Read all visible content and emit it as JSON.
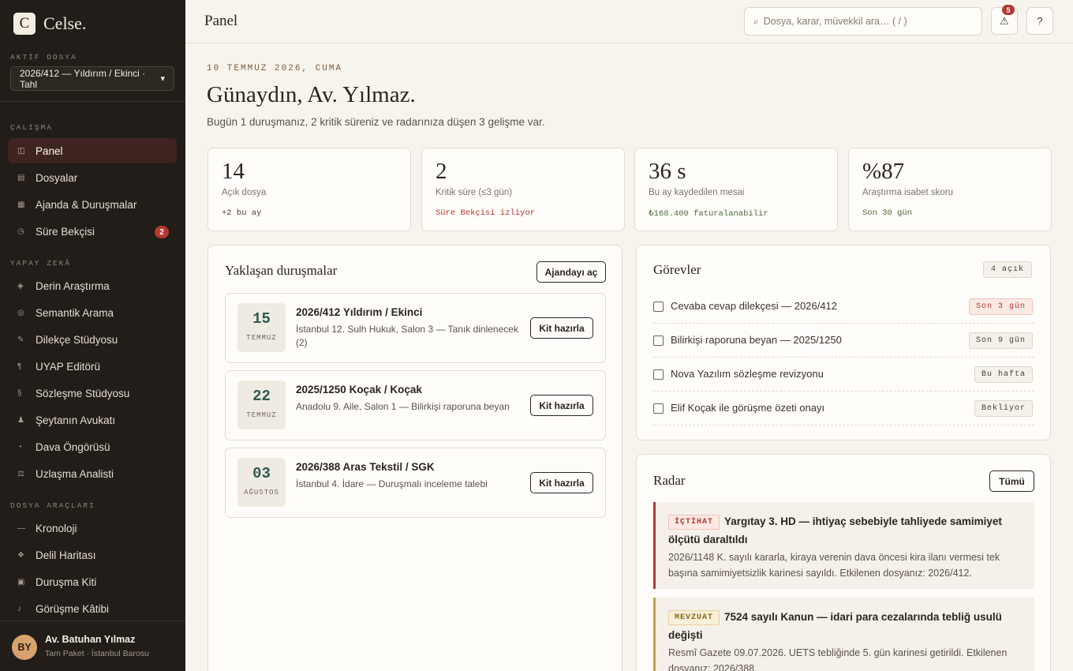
{
  "brand": {
    "mark": "C",
    "name": "Celse."
  },
  "sidebar": {
    "active_case_label": "AKTİF DOSYA",
    "active_case": "2026/412 — Yıldırım / Ekinci · Tahl",
    "sections": {
      "work": "ÇALIŞMA",
      "ai": "YAPAY ZEKÂ",
      "tools": "DOSYA ARAÇLARI"
    },
    "work_items": [
      {
        "label": "Panel",
        "icon": "panel-icon",
        "active": true
      },
      {
        "label": "Dosyalar",
        "icon": "folder-icon"
      },
      {
        "label": "Ajanda & Duruşmalar",
        "icon": "calendar-icon"
      },
      {
        "label": "Süre Bekçisi",
        "icon": "clock-icon",
        "badge": "2"
      }
    ],
    "ai_items": [
      {
        "label": "Derin Araştırma",
        "icon": "diamond-icon"
      },
      {
        "label": "Semantik Arama",
        "icon": "target-icon"
      },
      {
        "label": "Dilekçe Stüdyosu",
        "icon": "pen-icon"
      },
      {
        "label": "UYAP Editörü",
        "icon": "paragraph-icon"
      },
      {
        "label": "Sözleşme Stüdyosu",
        "icon": "section-icon"
      },
      {
        "label": "Şeytanın Avukatı",
        "icon": "person-icon"
      },
      {
        "label": "Dava Öngörüsü",
        "icon": "pie-icon"
      },
      {
        "label": "Uzlaşma Analisti",
        "icon": "handshake-icon"
      }
    ],
    "tool_items": [
      {
        "label": "Kronoloji",
        "icon": "line-icon"
      },
      {
        "label": "Delil Haritası",
        "icon": "cluster-icon"
      },
      {
        "label": "Duruşma Kiti",
        "icon": "kit-icon"
      },
      {
        "label": "Görüşme Kâtibi",
        "icon": "note-icon"
      }
    ],
    "user": {
      "initials": "BY",
      "name": "Av. Batuhan Yılmaz",
      "sub": "Tam Paket · İstanbul Barosu"
    }
  },
  "topbar": {
    "title": "Panel",
    "search_placeholder": "Dosya, karar, müvekkil ara…  ( / )",
    "notif_count": "5",
    "help": "?"
  },
  "header": {
    "date": "10 TEMMUZ 2026, CUMA",
    "greeting": "Günaydın, Av. Yılmaz.",
    "intro": "Bugün 1 duruşmanız, 2 kritik süreniz ve radarınıza düşen 3 gelişme var."
  },
  "stats": [
    {
      "value": "14",
      "label": "Açık dosya",
      "note": "+2 bu ay",
      "tone": "dark"
    },
    {
      "value": "2",
      "label": "Kritik süre (≤3 gün)",
      "note": "Süre Bekçisi izliyor",
      "tone": "red"
    },
    {
      "value": "36 s",
      "label": "Bu ay kaydedilen mesai",
      "note": "₺168.400 faturalanabilir",
      "tone": "green"
    },
    {
      "value": "%87",
      "label": "Araştırma isabet skoru",
      "note": "Son 30 gün",
      "tone": "green"
    }
  ],
  "hearings": {
    "title": "Yaklaşan duruşmalar",
    "open_button": "Ajandayı aç",
    "kit_button": "Kit hazırla",
    "items": [
      {
        "day": "15",
        "month": "TEMMUZ",
        "title": "2026/412 Yıldırım / Ekinci",
        "sub": "İstanbul 12. Sulh Hukuk, Salon 3 — Tanık dinlenecek (2)"
      },
      {
        "day": "22",
        "month": "TEMMUZ",
        "title": "2025/1250 Koçak / Koçak",
        "sub": "Anadolu 9. Aile, Salon 1 — Bilirkişi raporuna beyan"
      },
      {
        "day": "03",
        "month": "AĞUSTOS",
        "title": "2026/388 Aras Tekstil / SGK",
        "sub": "İstanbul 4. İdare — Duruşmalı inceleme talebi"
      }
    ]
  },
  "tasks": {
    "title": "Görevler",
    "count": "4 açık",
    "items": [
      {
        "label": "Cevaba cevap dilekçesi — 2026/412",
        "tag": "Son 3 gün",
        "urgent": true
      },
      {
        "label": "Bilirkişi raporuna beyan — 2025/1250",
        "tag": "Son 9 gün",
        "urgent": false
      },
      {
        "label": "Nova Yazılım sözleşme revizyonu",
        "tag": "Bu hafta",
        "urgent": false
      },
      {
        "label": "Elif Koçak ile görüşme özeti onayı",
        "tag": "Bekliyor",
        "urgent": false
      }
    ]
  },
  "radar": {
    "title": "Radar",
    "all_button": "Tümü",
    "items": [
      {
        "tag": "İÇTİHAT",
        "title": "Yargıtay 3. HD — ihtiyaç sebebiyle tahliyede samimiyet ölçütü daraltıldı",
        "text": "2026/1148 K. sayılı kararla, kiraya verenin dava öncesi kira ilanı vermesi tek başına samimiyetsizlik karinesi sayıldı. Etkilenen dosyanız: 2026/412."
      },
      {
        "tag": "MEVZUAT",
        "title": "7524 sayılı Kanun — idari para cezalarında tebliğ usulü değişti",
        "text": "Resmî Gazete 09.07.2026. UETS tebliğinde 5. gün karinesi getirildi. Etkilenen dosyanız: 2026/388."
      }
    ]
  }
}
